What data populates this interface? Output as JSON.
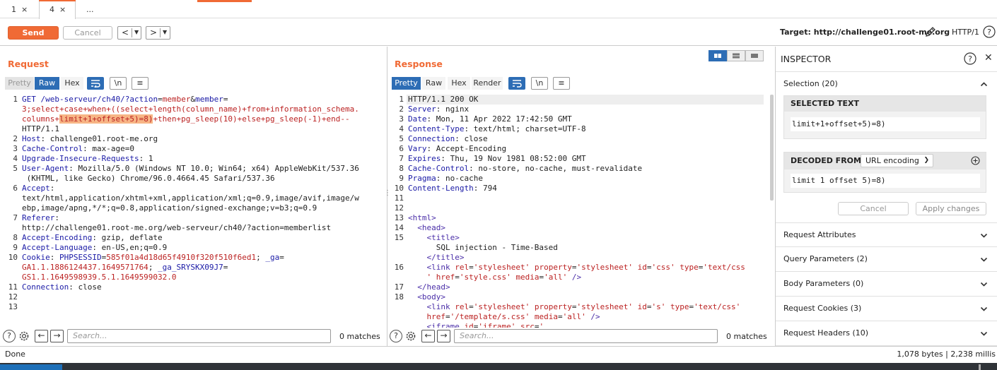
{
  "tabs": [
    {
      "label": "1",
      "close": "×"
    },
    {
      "label": "4",
      "close": "×"
    },
    {
      "label": "..."
    }
  ],
  "toolbar": {
    "send": "Send",
    "cancel": "Cancel",
    "back": "<",
    "forward": ">",
    "target": "Target: http://challenge01.root-me.org",
    "http": "HTTP/1",
    "help": "?"
  },
  "request": {
    "title": "Request",
    "tabs": [
      "Pretty",
      "Raw",
      "Hex"
    ],
    "newline_btn": "\\n",
    "search_placeholder": "Search...",
    "matches": "0 matches"
  },
  "response": {
    "title": "Response",
    "tabs": [
      "Pretty",
      "Raw",
      "Hex",
      "Render"
    ],
    "newline_btn": "\\n",
    "search_placeholder": "Search...",
    "matches": "0 matches"
  },
  "inspector": {
    "title": "INSPECTOR",
    "help": "?",
    "close": "✕",
    "selection": "Selection (20)",
    "selected_text_label": "SELECTED TEXT",
    "selected_text": "limit+1+offset+5)=8)",
    "decoded_from_label": "DECODED FROM:",
    "decoded_from_option": "URL encoding",
    "decoded_text": "limit 1 offset 5)=8)",
    "cancel": "Cancel",
    "apply": "Apply changes",
    "sections": [
      "Request Attributes",
      "Query Parameters (2)",
      "Body Parameters (0)",
      "Request Cookies (3)",
      "Request Headers (10)"
    ]
  },
  "status": {
    "left": "Done",
    "right": "1,078 bytes | 2,238 millis"
  },
  "colors": {
    "accent": "#f06a35",
    "blue": "#2d6db5",
    "value_red": "#b22222"
  }
}
